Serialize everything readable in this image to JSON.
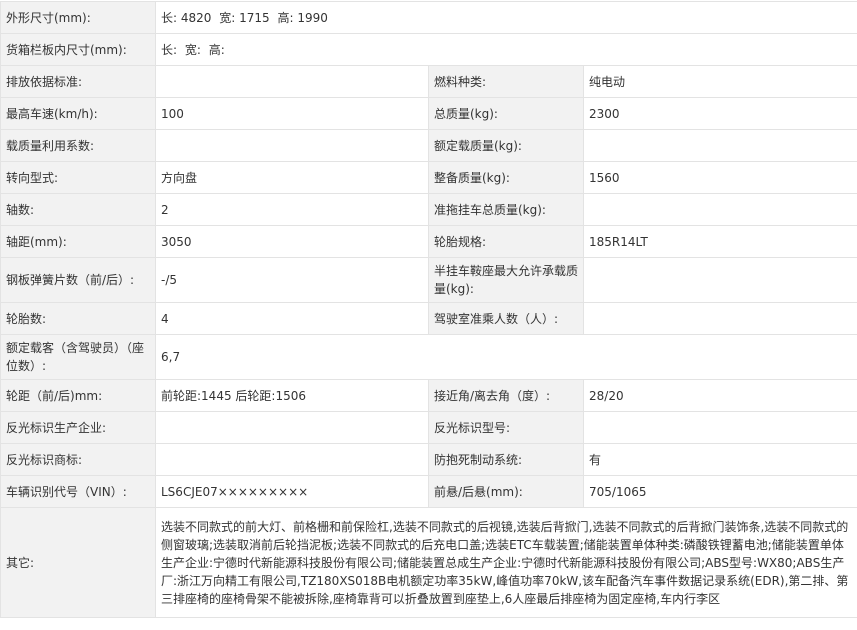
{
  "rows": {
    "outer_size_label": "外形尺寸(mm):",
    "outer_size": {
      "l_label": "长:",
      "l": "4820",
      "w_label": "宽:",
      "w": "1715",
      "h_label": "高:",
      "h": "1990"
    },
    "cargo_size_label": "货箱栏板内尺寸(mm):",
    "cargo_size": {
      "l_label": "长:",
      "w_label": "宽:",
      "h_label": "高:"
    },
    "emission_label": "排放依据标准:",
    "emission_value": "",
    "fuel_label": "燃料种类:",
    "fuel_value": "纯电动",
    "max_speed_label": "最高车速(km/h):",
    "max_speed_value": "100",
    "total_mass_label": "总质量(kg):",
    "total_mass_value": "2300",
    "load_util_label": "载质量利用系数:",
    "load_util_value": "",
    "rated_load_label": "额定载质量(kg):",
    "rated_load_value": "",
    "steering_label": "转向型式:",
    "steering_value": "方向盘",
    "curb_mass_label": "整备质量(kg):",
    "curb_mass_value": "1560",
    "axles_label": "轴数:",
    "axles_value": "2",
    "trailer_mass_label": "准拖挂车总质量(kg):",
    "trailer_mass_value": "",
    "wheelbase_label": "轴距(mm):",
    "wheelbase_value": "3050",
    "tire_spec_label": "轮胎规格:",
    "tire_spec_value": "185R14LT",
    "spring_label": "钢板弹簧片数（前/后）:",
    "spring_value": "-/5",
    "saddle_label": "半挂车鞍座最大允许承载质量(kg):",
    "saddle_value": "",
    "tires_label": "轮胎数:",
    "tires_value": "4",
    "cab_seats_label": "驾驶室准乘人数（人）:",
    "cab_seats_value": "",
    "passengers_label": "额定载客（含驾驶员）（座位数）:",
    "passengers_value": "6,7",
    "track_label": "轮距（前/后)mm:",
    "track_value": "前轮距:1445 后轮距:1506",
    "approach_label": "接近角/离去角（度）:",
    "approach_value": "28/20",
    "reflect_maker_label": "反光标识生产企业:",
    "reflect_maker_value": "",
    "reflect_model_label": "反光标识型号:",
    "reflect_model_value": "",
    "reflect_brand_label": "反光标识商标:",
    "reflect_brand_value": "",
    "abs_label": "防抱死制动系统:",
    "abs_value": "有",
    "vin_label": "车辆识别代号（VIN）:",
    "vin_value": "LS6CJE07×××××××××",
    "overhang_label": "前悬/后悬(mm):",
    "overhang_value": "705/1065",
    "other_label": "其它:",
    "other_value": "选装不同款式的前大灯、前格栅和前保险杠,选装不同款式的后视镜,选装后背掀门,选装不同款式的后背掀门装饰条,选装不同款式的侧窗玻璃;选装取消前后轮挡泥板;选装不同款式的后充电口盖;选装ETC车载装置;储能装置单体种类:磷酸铁锂蓄电池;储能装置单体生产企业:宁德时代新能源科技股份有限公司;储能装置总成生产企业:宁德时代新能源科技股份有限公司;ABS型号:WX80;ABS生产厂:浙江万向精工有限公司,TZ180XS018B电机额定功率35kW,峰值功率70kW,该车配备汽车事件数据记录系统(EDR),第二排、第三排座椅的座椅骨架不能被拆除,座椅靠背可以折叠放置到座垫上,6人座最后排座椅为固定座椅,车内行李区"
  }
}
